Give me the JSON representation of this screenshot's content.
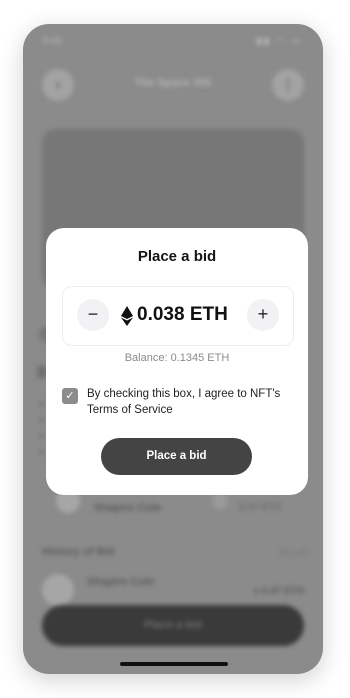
{
  "status_bar": {
    "time": "9:41",
    "icons": "▮▮ ◠ ▭"
  },
  "nav": {
    "back_icon": "‹",
    "title": "The Space 305",
    "more_icon": "⋮"
  },
  "bid_preview": {
    "name": "Shapire Cole",
    "amount": "0.47 ETH"
  },
  "history": {
    "title": "History of Bid",
    "see_all": "See all",
    "row": {
      "name": "Shapire Cole",
      "amount": "♦ 0.47 ETH"
    }
  },
  "bottom_button": "Place a bid",
  "modal": {
    "title": "Place a bid",
    "minus": "−",
    "plus": "+",
    "amount": "0.038 ETH",
    "balance": "Balance: 0.1345 ETH",
    "checkbox_checked": true,
    "agree_text": "By checking this box, I agree to NFT's Terms of Service",
    "submit": "Place a bid"
  }
}
